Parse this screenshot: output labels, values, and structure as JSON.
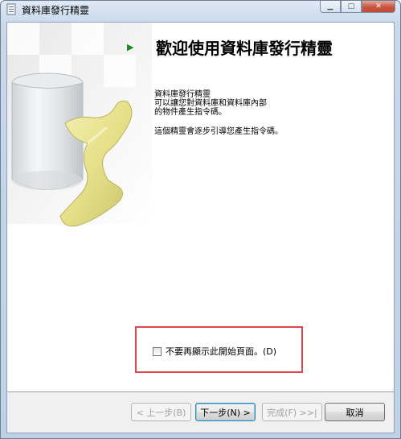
{
  "window": {
    "title": "資料庫發行精靈",
    "minimize_icon": "minimize-icon",
    "maximize_icon": "maximize-icon",
    "close_icon": "close-icon"
  },
  "welcome": {
    "heading": "歡迎使用資料庫發行精靈",
    "intro_lines": "資料庫發行精靈\n可以讓您對資料庫和資料庫內部\n的物件產生指令碼。",
    "guide_text": "這個精靈會逐步引導您產生指令碼。"
  },
  "option": {
    "dont_show_label": "不要再顯示此開始頁面。(D)",
    "checked": false
  },
  "buttons": {
    "prev_label": "< 上一步(B)",
    "next_label": "下一步(N) >",
    "finish_label": "完成(F) >>|",
    "cancel_label": "取消"
  },
  "colors": {
    "highlight_border": "#e0474c",
    "arrow": "#1a8a1a"
  }
}
